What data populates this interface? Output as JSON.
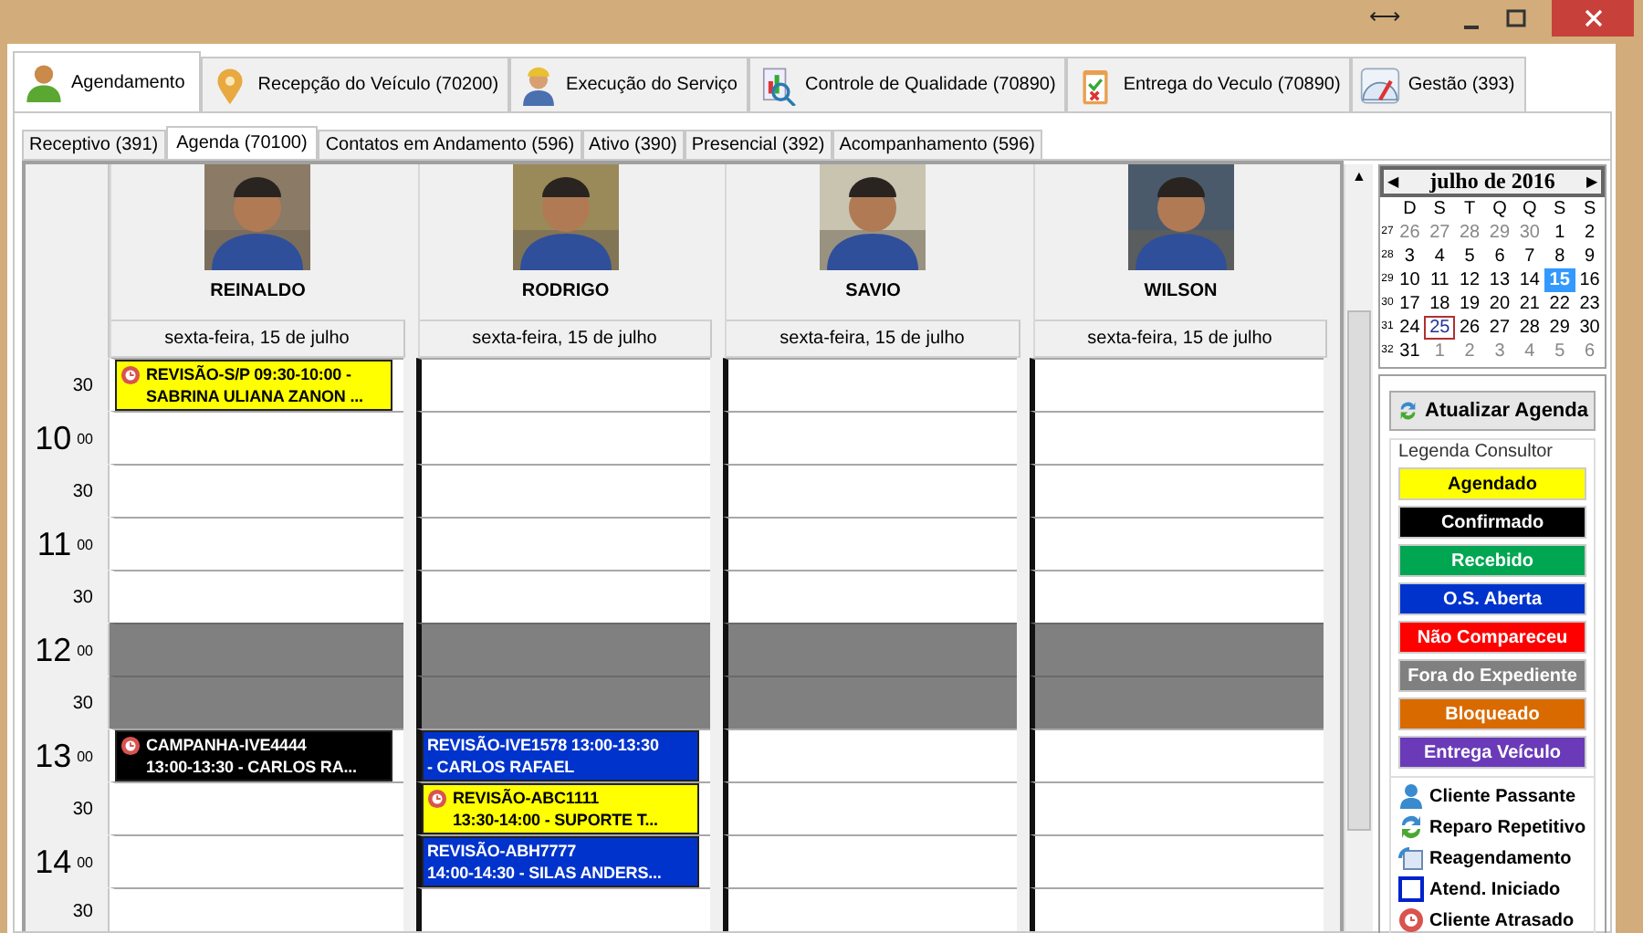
{
  "window": {
    "resize": "⟷"
  },
  "main_tabs": [
    {
      "label": "Agendamento",
      "selected": true
    },
    {
      "label": "Recepção do Veículo (70200)",
      "selected": false
    },
    {
      "label": "Execução do Serviço",
      "selected": false
    },
    {
      "label": "Controle de Qualidade (70890)",
      "selected": false
    },
    {
      "label": "Entrega do Veculo (70890)",
      "selected": false
    },
    {
      "label": "Gestão (393)",
      "selected": false
    }
  ],
  "scroll_up": "▲",
  "sub_tabs": [
    {
      "label": "Receptivo (391)",
      "selected": false
    },
    {
      "label": "Agenda (70100)",
      "selected": true
    },
    {
      "label": "Contatos em Andamento (596)",
      "selected": false
    },
    {
      "label": "Ativo (390)",
      "selected": false
    },
    {
      "label": "Presencial (392)",
      "selected": false
    },
    {
      "label": "Acompanhamento (596)",
      "selected": false
    }
  ],
  "consultants": [
    {
      "name": "REINALDO",
      "date": "sexta-feira, 15 de julho"
    },
    {
      "name": "RODRIGO",
      "date": "sexta-feira, 15 de julho"
    },
    {
      "name": "SAVIO",
      "date": "sexta-feira, 15 de julho"
    },
    {
      "name": "WILSON",
      "date": "sexta-feira, 15 de julho"
    }
  ],
  "rows": [
    {
      "minute": "30",
      "blocked": false,
      "cells": [
        [
          {
            "color": "#ffff00",
            "late": true,
            "lines": [
              "REVISÃO-S/P 09:30-10:00 -",
              "SABRINA ULIANA ZANON ..."
            ]
          }
        ],
        [],
        [],
        []
      ]
    },
    {
      "hour": "10",
      "minute": "00",
      "blocked": false,
      "cells": [
        [],
        [],
        [],
        []
      ]
    },
    {
      "minute": "30",
      "blocked": false,
      "cells": [
        [],
        [],
        [],
        []
      ]
    },
    {
      "hour": "11",
      "minute": "00",
      "blocked": false,
      "cells": [
        [],
        [],
        [],
        []
      ]
    },
    {
      "minute": "30",
      "blocked": false,
      "cells": [
        [],
        [],
        [],
        []
      ]
    },
    {
      "hour": "12",
      "minute": "00",
      "blocked": true,
      "cells": [
        [],
        [],
        [],
        []
      ]
    },
    {
      "minute": "30",
      "blocked": true,
      "cells": [
        [],
        [],
        [],
        []
      ]
    },
    {
      "hour": "13",
      "minute": "00",
      "blocked": false,
      "cells": [
        [
          {
            "color": "#000000",
            "late": true,
            "lines": [
              "CAMPANHA-IVE4444",
              "13:00-13:30 - CARLOS RA..."
            ]
          }
        ],
        [
          {
            "color": "#0033cc",
            "late": false,
            "lines": [
              "REVISÃO-IVE1578 13:00-13:30",
              "- CARLOS RAFAEL"
            ]
          }
        ],
        [],
        []
      ]
    },
    {
      "minute": "30",
      "blocked": false,
      "cells": [
        [],
        [
          {
            "color": "#ffff00",
            "late": true,
            "lines": [
              "REVISÃO-ABC1111",
              "13:30-14:00 - SUPORTE T..."
            ]
          }
        ],
        [],
        []
      ]
    },
    {
      "hour": "14",
      "minute": "00",
      "blocked": false,
      "cells": [
        [],
        [
          {
            "color": "#0033cc",
            "late": false,
            "lines": [
              "REVISÃO-ABH7777",
              "14:00-14:30 - SILAS ANDERS..."
            ]
          }
        ],
        [],
        []
      ]
    },
    {
      "minute": "30",
      "blocked": false,
      "cells": [
        [],
        [],
        [],
        []
      ]
    }
  ],
  "calendar": {
    "prev": "◀",
    "title": "julho de 2016",
    "next": "▶",
    "weekdays": [
      "D",
      "S",
      "T",
      "Q",
      "Q",
      "S",
      "S"
    ],
    "weeks": [
      {
        "week": "27",
        "days": [
          {
            "d": "26",
            "outside": true,
            "selected": false,
            "today": false
          },
          {
            "d": "27",
            "outside": true,
            "selected": false,
            "today": false
          },
          {
            "d": "28",
            "outside": true,
            "selected": false,
            "today": false
          },
          {
            "d": "29",
            "outside": true,
            "selected": false,
            "today": false
          },
          {
            "d": "30",
            "outside": true,
            "selected": false,
            "today": false
          },
          {
            "d": "1",
            "outside": false,
            "selected": false,
            "today": false
          },
          {
            "d": "2",
            "outside": false,
            "selected": false,
            "today": false
          }
        ]
      },
      {
        "week": "28",
        "days": [
          {
            "d": "3",
            "outside": false,
            "selected": false,
            "today": false
          },
          {
            "d": "4",
            "outside": false,
            "selected": false,
            "today": false
          },
          {
            "d": "5",
            "outside": false,
            "selected": false,
            "today": false
          },
          {
            "d": "6",
            "outside": false,
            "selected": false,
            "today": false
          },
          {
            "d": "7",
            "outside": false,
            "selected": false,
            "today": false
          },
          {
            "d": "8",
            "outside": false,
            "selected": false,
            "today": false
          },
          {
            "d": "9",
            "outside": false,
            "selected": false,
            "today": false
          }
        ]
      },
      {
        "week": "29",
        "days": [
          {
            "d": "10",
            "outside": false,
            "selected": false,
            "today": false
          },
          {
            "d": "11",
            "outside": false,
            "selected": false,
            "today": false
          },
          {
            "d": "12",
            "outside": false,
            "selected": false,
            "today": false
          },
          {
            "d": "13",
            "outside": false,
            "selected": false,
            "today": false
          },
          {
            "d": "14",
            "outside": false,
            "selected": false,
            "today": false
          },
          {
            "d": "15",
            "outside": false,
            "selected": true,
            "today": false
          },
          {
            "d": "16",
            "outside": false,
            "selected": false,
            "today": false
          }
        ]
      },
      {
        "week": "30",
        "days": [
          {
            "d": "17",
            "outside": false,
            "selected": false,
            "today": false
          },
          {
            "d": "18",
            "outside": false,
            "selected": false,
            "today": false
          },
          {
            "d": "19",
            "outside": false,
            "selected": false,
            "today": false
          },
          {
            "d": "20",
            "outside": false,
            "selected": false,
            "today": false
          },
          {
            "d": "21",
            "outside": false,
            "selected": false,
            "today": false
          },
          {
            "d": "22",
            "outside": false,
            "selected": false,
            "today": false
          },
          {
            "d": "23",
            "outside": false,
            "selected": false,
            "today": false
          }
        ]
      },
      {
        "week": "31",
        "days": [
          {
            "d": "24",
            "outside": false,
            "selected": false,
            "today": false
          },
          {
            "d": "25",
            "outside": false,
            "selected": false,
            "today": true
          },
          {
            "d": "26",
            "outside": false,
            "selected": false,
            "today": false
          },
          {
            "d": "27",
            "outside": false,
            "selected": false,
            "today": false
          },
          {
            "d": "28",
            "outside": false,
            "selected": false,
            "today": false
          },
          {
            "d": "29",
            "outside": false,
            "selected": false,
            "today": false
          },
          {
            "d": "30",
            "outside": false,
            "selected": false,
            "today": false
          }
        ]
      },
      {
        "week": "32",
        "days": [
          {
            "d": "31",
            "outside": false,
            "selected": false,
            "today": false
          },
          {
            "d": "1",
            "outside": true,
            "selected": false,
            "today": false
          },
          {
            "d": "2",
            "outside": true,
            "selected": false,
            "today": false
          },
          {
            "d": "3",
            "outside": true,
            "selected": false,
            "today": false
          },
          {
            "d": "4",
            "outside": true,
            "selected": false,
            "today": false
          },
          {
            "d": "5",
            "outside": true,
            "selected": false,
            "today": false
          },
          {
            "d": "6",
            "outside": true,
            "selected": false,
            "today": false
          }
        ]
      }
    ]
  },
  "refresh_button": "Atualizar Agenda",
  "legend": {
    "title": "Legenda Consultor",
    "statuses": [
      {
        "label": "Agendado",
        "color": "#ffff00"
      },
      {
        "label": "Confirmado",
        "color": "#000000"
      },
      {
        "label": "Recebido",
        "color": "#00a651"
      },
      {
        "label": "O.S. Aberta",
        "color": "#0033cc"
      },
      {
        "label": "Não Compareceu",
        "color": "#ff0000"
      },
      {
        "label": "Fora do Expediente",
        "color": "#808080"
      },
      {
        "label": "Bloqueado",
        "color": "#d96a00"
      },
      {
        "label": "Entrega Veículo",
        "color": "#6a3ab8"
      }
    ],
    "markers": [
      {
        "kind": "person",
        "label": "Cliente Passante"
      },
      {
        "kind": "repeat",
        "label": "Reparo Repetitivo"
      },
      {
        "kind": "reschedule",
        "label": "Reagendamento"
      },
      {
        "kind": "square",
        "label": "Atend. Iniciado"
      },
      {
        "kind": "late",
        "label": "Cliente Atrasado"
      }
    ]
  }
}
